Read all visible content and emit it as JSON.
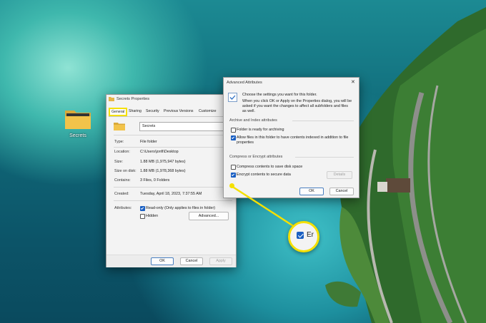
{
  "desktop": {
    "folder_label": "Secrets"
  },
  "properties": {
    "title": "Secrets Properties",
    "tabs": [
      "General",
      "Sharing",
      "Security",
      "Previous Versions",
      "Customize"
    ],
    "name_value": "Secrets",
    "rows": [
      {
        "label": "Type:",
        "value": "File folder"
      },
      {
        "label": "Location:",
        "value": "C:\\Users\\jonfi\\Desktop"
      },
      {
        "label": "Size:",
        "value": "1.88 MB (1,975,947 bytes)"
      },
      {
        "label": "Size on disk:",
        "value": "1.88 MB (1,978,368 bytes)"
      },
      {
        "label": "Contains:",
        "value": "3 Files, 0 Folders"
      },
      {
        "label": "Created:",
        "value": "Tuesday, April 18, 2023, 7:37:55 AM"
      }
    ],
    "attributes_label": "Attributes:",
    "readonly_label": "Read-only (Only applies to files in folder)",
    "hidden_label": "Hidden",
    "advanced_button": "Advanced...",
    "ok_button": "OK",
    "cancel_button": "Cancel",
    "apply_button": "Apply"
  },
  "advanced": {
    "title": "Advanced Attributes",
    "close_glyph": "✕",
    "intro_line1": "Choose the settings you want for this folder.",
    "intro_line2": "When you click OK or Apply on the Properties dialog, you will be",
    "intro_line3": "asked if you want the changes to affect all subfolders and files",
    "intro_line4": "as well.",
    "archive_header": "Archive and Index attributes",
    "archive_option": "Folder is ready for archiving",
    "index_option_line1": "Allow files in this folder to have contents indexed in addition to file",
    "index_option_line2": "properties",
    "compress_header": "Compress or Encrypt attributes",
    "compress_option": "Compress contents to save disk space",
    "encrypt_option": "Encrypt contents to secure data",
    "details_button": "Details",
    "ok_button": "OK",
    "cancel_button": "Cancel"
  },
  "zoom": {
    "text": "Er"
  },
  "colors": {
    "highlight": "#f5e000",
    "checkbox": "#1a5fc2"
  }
}
